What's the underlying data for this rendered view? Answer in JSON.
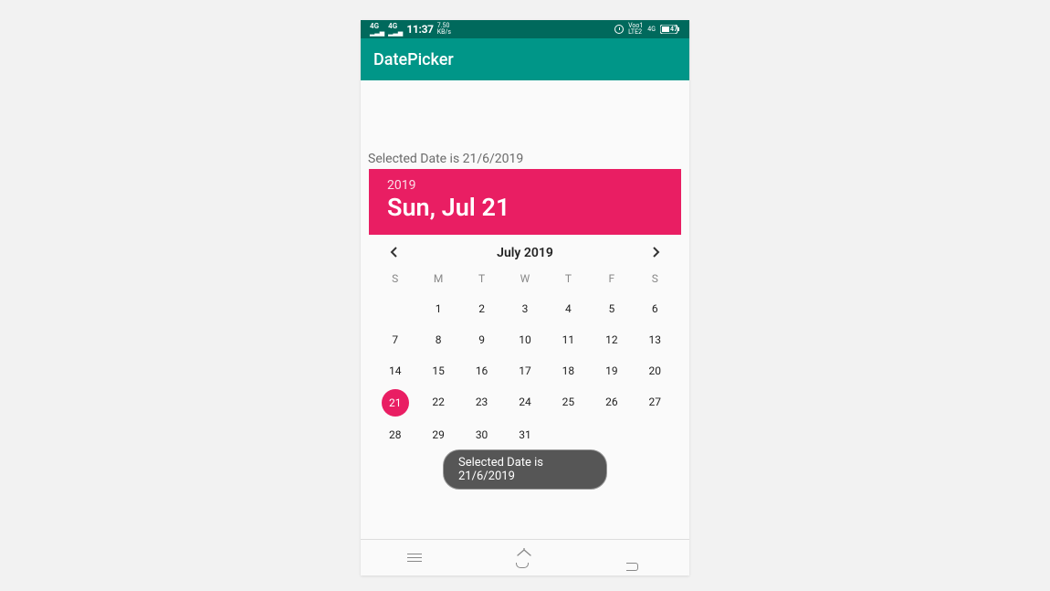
{
  "statusbar": {
    "network_left_1": "4G",
    "network_left_2": "4G",
    "time": "11:37",
    "speed": "7.50",
    "speed_unit": "KB/s",
    "alarm": "alarm",
    "carrier1": "Voo1",
    "carrier2": "LTE2",
    "net_right": "4G",
    "battery": "47"
  },
  "appbar": {
    "title": "DatePicker"
  },
  "selected_label": "Selected Date is 21/6/2019",
  "picker": {
    "year": "2019",
    "date_line": "Sun, Jul 21",
    "month_label": "July 2019"
  },
  "weekdays": [
    "S",
    "M",
    "T",
    "W",
    "T",
    "F",
    "S"
  ],
  "cells": [
    "",
    "1",
    "2",
    "3",
    "4",
    "5",
    "6",
    "7",
    "8",
    "9",
    "10",
    "11",
    "12",
    "13",
    "14",
    "15",
    "16",
    "17",
    "18",
    "19",
    "20",
    "21",
    "22",
    "23",
    "24",
    "25",
    "26",
    "27",
    "28",
    "29",
    "30",
    "31",
    "",
    "",
    ""
  ],
  "selected_day": "21",
  "toast": "Selected Date is 21/6/2019"
}
